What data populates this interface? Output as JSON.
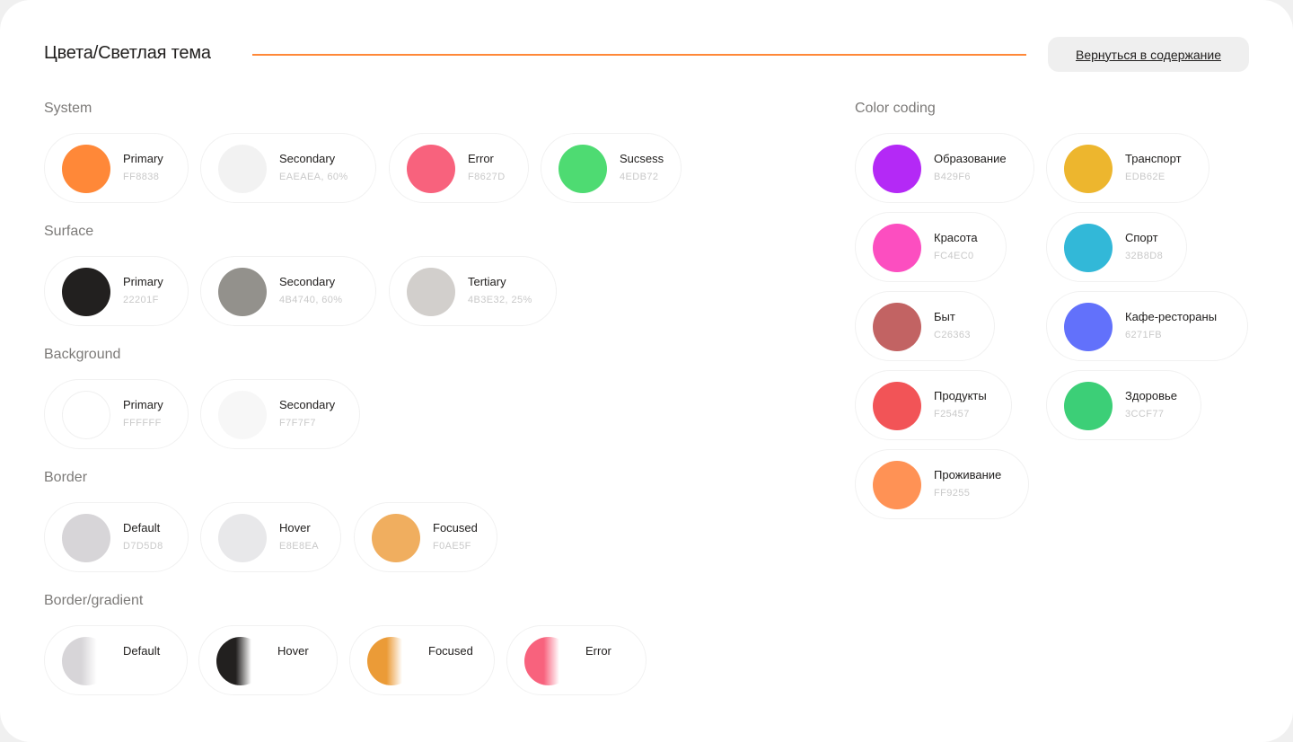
{
  "header": {
    "title": "Цвета/Светлая тема",
    "back_label": "Вернуться в содержание",
    "accent": "#FF8838"
  },
  "groups": {
    "system": {
      "title": "System",
      "items": [
        {
          "name": "Primary",
          "code": "FF8838",
          "color": "#FF8838"
        },
        {
          "name": "Secondary",
          "code": "EAEAEA, 60%",
          "color": "rgba(234,234,234,0.6)"
        },
        {
          "name": "Error",
          "code": "F8627D",
          "color": "#F8627D"
        },
        {
          "name": "Sucsess",
          "code": "4EDB72",
          "color": "#4EDB72"
        }
      ]
    },
    "surface": {
      "title": "Surface",
      "items": [
        {
          "name": "Primary",
          "code": "22201F",
          "color": "#22201F"
        },
        {
          "name": "Secondary",
          "code": "4B4740, 60%",
          "color": "rgba(75,71,64,0.6)"
        },
        {
          "name": "Tertiary",
          "code": "4B3E32, 25%",
          "color": "rgba(75,62,50,0.25)"
        }
      ]
    },
    "background": {
      "title": "Background",
      "items": [
        {
          "name": "Primary",
          "code": "FFFFFF",
          "color": "#FFFFFF"
        },
        {
          "name": "Secondary",
          "code": "F7F7F7",
          "color": "#F7F7F7"
        }
      ]
    },
    "border": {
      "title": "Border",
      "items": [
        {
          "name": "Default",
          "code": "D7D5D8",
          "color": "#D7D5D8"
        },
        {
          "name": "Hover",
          "code": "E8E8EA",
          "color": "#E8E8EA"
        },
        {
          "name": "Focused",
          "code": "F0AE5F",
          "color": "#F0AE5F"
        }
      ]
    },
    "border_gradient": {
      "title": "Border/gradient",
      "items": [
        {
          "name": "Default",
          "color": "#D7D5D8"
        },
        {
          "name": "Hover",
          "color": "#22201F"
        },
        {
          "name": "Focused",
          "color": "#EB9B37"
        },
        {
          "name": "Error",
          "color": "#F8627D"
        }
      ]
    },
    "color_coding": {
      "title": "Color coding",
      "items": [
        {
          "name": "Образование",
          "code": "B429F6",
          "color": "#B429F6"
        },
        {
          "name": "Транспорт",
          "code": "EDB62E",
          "color": "#EDB62E"
        },
        {
          "name": "Красота",
          "code": "FC4EC0",
          "color": "#FC4EC0"
        },
        {
          "name": "Спорт",
          "code": "32B8D8",
          "color": "#32B8D8"
        },
        {
          "name": "Быт",
          "code": "C26363",
          "color": "#C26363"
        },
        {
          "name": "Кафе-рестораны",
          "code": "6271FB",
          "color": "#6271FB"
        },
        {
          "name": "Продукты",
          "code": "F25457",
          "color": "#F25457"
        },
        {
          "name": "Здоровье",
          "code": "3CCF77",
          "color": "#3CCF77"
        },
        {
          "name": "Проживание",
          "code": "FF9255",
          "color": "#FF9255"
        }
      ]
    }
  }
}
